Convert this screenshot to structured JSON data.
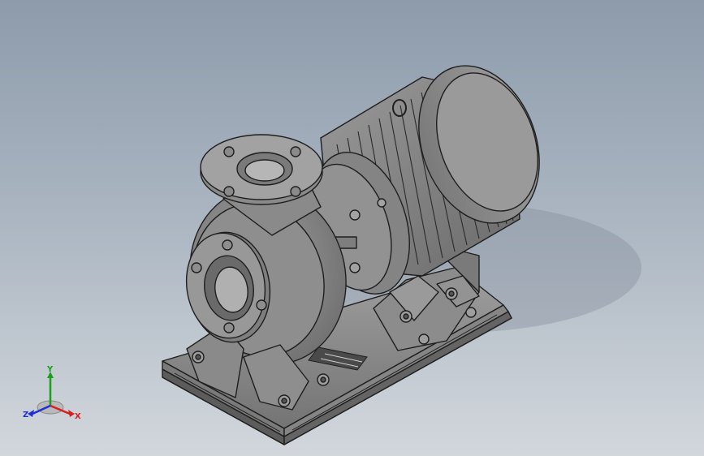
{
  "viewport": {
    "background_top": "#8d9bab",
    "background_bottom": "#d2d7dc"
  },
  "model": {
    "icon": "centrifugal-pump-motor-assembly-icon",
    "body_color": "#8a8a8a",
    "edge_color": "#1e1e1e"
  },
  "triad": {
    "x_label": "X",
    "y_label": "Y",
    "z_label": "Z",
    "x_color": "#d62020",
    "y_color": "#18a018",
    "z_color": "#2030d0"
  }
}
